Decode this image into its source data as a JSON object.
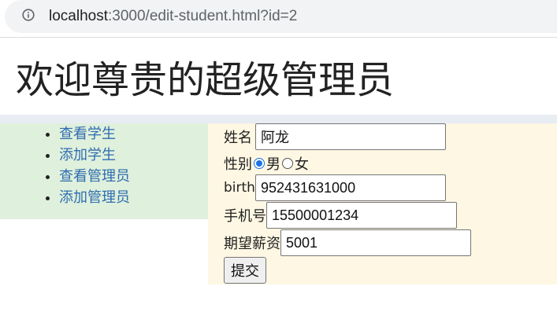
{
  "browser": {
    "url_host": "localhost",
    "url_rest": ":3000/edit-student.html?id=2"
  },
  "page": {
    "title": "欢迎尊贵的超级管理员"
  },
  "sidebar": {
    "items": [
      {
        "label": "查看学生"
      },
      {
        "label": "添加学生"
      },
      {
        "label": "查看管理员"
      },
      {
        "label": "添加管理员"
      }
    ]
  },
  "form": {
    "name": {
      "label": "姓名",
      "value": "阿龙"
    },
    "gender": {
      "label": "性别",
      "options": [
        "男",
        "女"
      ],
      "selected": "男"
    },
    "birth": {
      "label": "birth",
      "value": "952431631000"
    },
    "phone": {
      "label": "手机号",
      "value": "15500001234"
    },
    "salary": {
      "label": "期望薪资",
      "value": "5001"
    },
    "submit_label": "提交"
  },
  "colors": {
    "sidebar_bg": "#dff0dc",
    "content_bg": "#fdf7e3",
    "link": "#2f6db0",
    "band": "#e8ecf3"
  }
}
